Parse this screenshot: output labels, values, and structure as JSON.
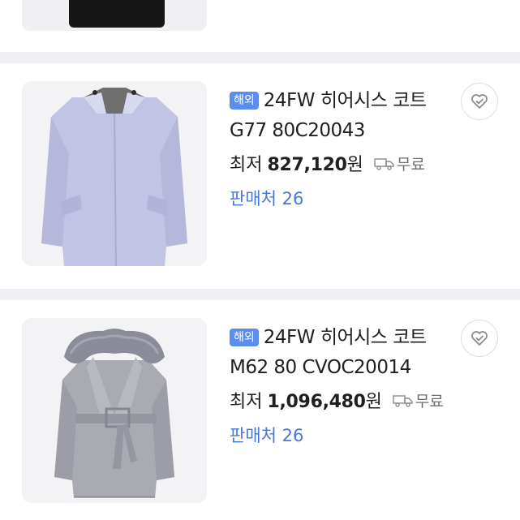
{
  "products": [
    {
      "badge": "해외",
      "title": "24FW 히어시스 코트 G77 80C20043",
      "price_prefix": "최저",
      "price_value": "827,120",
      "price_unit": "원",
      "shipping": "무료",
      "sellers": "판매처 26",
      "image_icon": "lavender-coat-image",
      "wish_icon": "heart-check-icon"
    },
    {
      "badge": "해외",
      "title": "24FW 히어시스 코트 M62 80 CVOC20014",
      "price_prefix": "최저",
      "price_value": "1,096,480",
      "price_unit": "원",
      "shipping": "무료",
      "sellers": "판매처 26",
      "image_icon": "grey-fur-coat-image",
      "wish_icon": "heart-check-icon"
    }
  ],
  "colors": {
    "badge": "#5b8def",
    "sellers_link": "#4677d9",
    "separator": "#eef0f3",
    "shipping_text": "#6e6e6e"
  }
}
